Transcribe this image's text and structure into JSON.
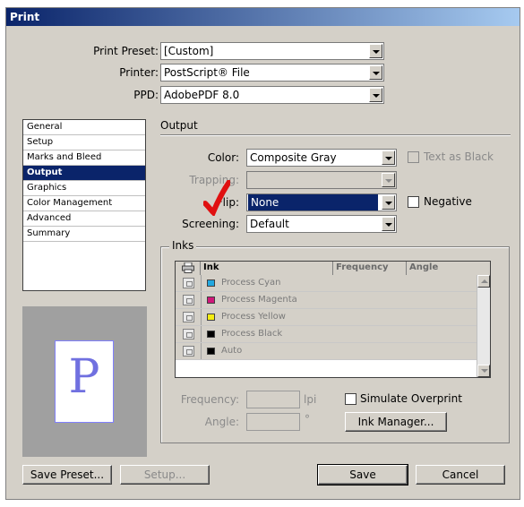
{
  "window": {
    "title": "Print"
  },
  "top": {
    "preset_label": "Print Preset:",
    "preset_value": "[Custom]",
    "printer_label": "Printer:",
    "printer_value": "PostScript® File",
    "ppd_label": "PPD:",
    "ppd_value": "AdobePDF 8.0"
  },
  "sidebar": {
    "items": [
      {
        "label": "General"
      },
      {
        "label": "Setup"
      },
      {
        "label": "Marks and Bleed"
      },
      {
        "label": "Output",
        "active": true
      },
      {
        "label": "Graphics"
      },
      {
        "label": "Color Management"
      },
      {
        "label": "Advanced"
      },
      {
        "label": "Summary"
      }
    ]
  },
  "preview": {
    "letter": "P"
  },
  "output": {
    "section_title": "Output",
    "color_label": "Color:",
    "color_value": "Composite Gray",
    "text_as_black_label": "Text as Black",
    "trapping_label": "Trapping:",
    "trapping_value": "",
    "flip_label": "Flip:",
    "flip_value": "None",
    "negative_label": "Negative",
    "screening_label": "Screening:",
    "screening_value": "Default"
  },
  "inks": {
    "group_title": "Inks",
    "columns": [
      "Ink",
      "Frequency",
      "Angle"
    ],
    "rows": [
      {
        "name": "Process Cyan",
        "color": "#22a8e0"
      },
      {
        "name": "Process Magenta",
        "color": "#d0187a"
      },
      {
        "name": "Process Yellow",
        "color": "#f4ec10"
      },
      {
        "name": "Process Black",
        "color": "#000000"
      },
      {
        "name": "Auto",
        "color": "#000000"
      }
    ],
    "frequency_label": "Frequency:",
    "frequency_unit": "lpi",
    "angle_label": "Angle:",
    "angle_unit": "°",
    "simulate_overprint_label": "Simulate Overprint",
    "ink_manager_label": "Ink Manager..."
  },
  "buttons": {
    "save_preset": "Save Preset...",
    "setup": "Setup...",
    "save": "Save",
    "cancel": "Cancel"
  },
  "colors": {
    "titlebar": "#0a246a",
    "selection": "#0a246a",
    "dialog_bg": "#d4d0c8",
    "annotation_check": "#e01010"
  }
}
